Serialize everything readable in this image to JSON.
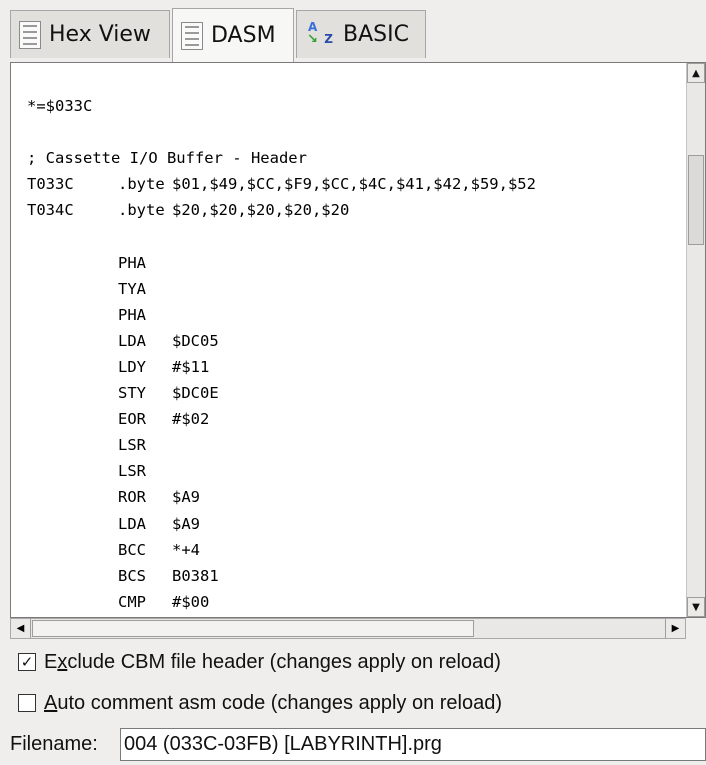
{
  "tabs": [
    {
      "label": "Hex View",
      "icon": "document-icon",
      "active": false
    },
    {
      "label": "DASM",
      "icon": "document-icon",
      "active": true
    },
    {
      "label": "BASIC",
      "icon": "basic-az-icon",
      "active": false
    }
  ],
  "code": {
    "origin": "*=$033C",
    "comment": "; Cassette I/O Buffer - Header",
    "data_lines": [
      {
        "label": "T033C",
        "mnemonic": ".byte",
        "operand": "$01,$49,$CC,$F9,$CC,$4C,$41,$42,$59,$52"
      },
      {
        "label": "T034C",
        "mnemonic": ".byte",
        "operand": "$20,$20,$20,$20,$20"
      }
    ],
    "instructions": [
      {
        "mnemonic": "PHA",
        "operand": ""
      },
      {
        "mnemonic": "TYA",
        "operand": ""
      },
      {
        "mnemonic": "PHA",
        "operand": ""
      },
      {
        "mnemonic": "LDA",
        "operand": "$DC05"
      },
      {
        "mnemonic": "LDY",
        "operand": "#$11"
      },
      {
        "mnemonic": "STY",
        "operand": "$DC0E"
      },
      {
        "mnemonic": "EOR",
        "operand": "#$02"
      },
      {
        "mnemonic": "LSR",
        "operand": ""
      },
      {
        "mnemonic": "LSR",
        "operand": ""
      },
      {
        "mnemonic": "ROR",
        "operand": "$A9"
      },
      {
        "mnemonic": "LDA",
        "operand": "$A9"
      },
      {
        "mnemonic": "BCC",
        "operand": "*+4"
      },
      {
        "mnemonic": "BCS",
        "operand": "B0381"
      },
      {
        "mnemonic": "CMP",
        "operand": "#$00"
      }
    ]
  },
  "options": {
    "exclude_header": {
      "pre": "E",
      "mnemonic": "x",
      "post": "clude CBM file header (changes apply on reload)",
      "checked": true,
      "check_glyph": "✓"
    },
    "auto_comment": {
      "pre": "",
      "mnemonic": "A",
      "post": "uto comment asm code (changes apply on reload)",
      "checked": false,
      "check_glyph": ""
    }
  },
  "filename": {
    "label": "Filename:",
    "value": "004 (033C-03FB) [LABYRINTH].prg"
  },
  "scrollbars": {
    "up_arrow": "▲",
    "down_arrow": "▼",
    "left_arrow": "◀",
    "right_arrow": "▶"
  }
}
